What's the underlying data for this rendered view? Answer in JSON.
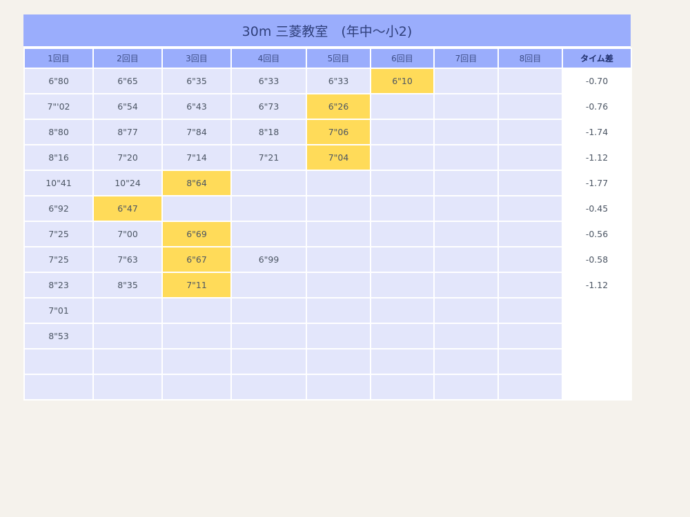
{
  "title": "30m 三菱教室　(年中〜小2)",
  "headers": [
    "1回目",
    "2回目",
    "3回目",
    "4回目",
    "5回目",
    "6回目",
    "7回目",
    "8回目",
    "タイム差"
  ],
  "rows": [
    {
      "cells": [
        "6\"80",
        "6\"65",
        "6\"35",
        "6\"33",
        "6\"33",
        "6\"10",
        "",
        ""
      ],
      "best": 5,
      "diff": "-0.70"
    },
    {
      "cells": [
        "7\"'02",
        "6\"54",
        "6\"43",
        "6\"73",
        "6\"26",
        "",
        "",
        ""
      ],
      "best": 4,
      "diff": "-0.76"
    },
    {
      "cells": [
        "8\"80",
        "8\"77",
        "7\"84",
        "8\"18",
        "7\"06",
        "",
        "",
        ""
      ],
      "best": 4,
      "diff": "-1.74"
    },
    {
      "cells": [
        "8\"16",
        "7\"20",
        "7\"14",
        "7\"21",
        "7\"04",
        "",
        "",
        ""
      ],
      "best": 4,
      "diff": "-1.12"
    },
    {
      "cells": [
        "10\"41",
        "10\"24",
        "8\"64",
        "",
        "",
        "",
        "",
        ""
      ],
      "best": 2,
      "diff": "-1.77"
    },
    {
      "cells": [
        "6\"92",
        "6\"47",
        "",
        "",
        "",
        "",
        "",
        ""
      ],
      "best": 1,
      "diff": "-0.45"
    },
    {
      "cells": [
        "7\"25",
        "7\"00",
        "6\"69",
        "",
        "",
        "",
        "",
        ""
      ],
      "best": 2,
      "diff": "-0.56"
    },
    {
      "cells": [
        "7\"25",
        "7\"63",
        "6\"67",
        "6\"99",
        "",
        "",
        "",
        ""
      ],
      "best": 2,
      "diff": "-0.58"
    },
    {
      "cells": [
        "8\"23",
        "8\"35",
        "7\"11",
        "",
        "",
        "",
        "",
        ""
      ],
      "best": 2,
      "diff": "-1.12"
    },
    {
      "cells": [
        "7\"01",
        "",
        "",
        "",
        "",
        "",
        "",
        ""
      ],
      "best": -1,
      "diff": ""
    },
    {
      "cells": [
        "8\"53",
        "",
        "",
        "",
        "",
        "",
        "",
        ""
      ],
      "best": -1,
      "diff": ""
    },
    {
      "cells": [
        "",
        "",
        "",
        "",
        "",
        "",
        "",
        ""
      ],
      "best": -1,
      "diff": ""
    },
    {
      "cells": [
        "",
        "",
        "",
        "",
        "",
        "",
        "",
        ""
      ],
      "best": -1,
      "diff": ""
    }
  ],
  "colors": {
    "header_bg": "#9aadfc",
    "cell_bg": "#e3e6fb",
    "best_bg": "#ffdb59",
    "diff_bg": "#ffffff",
    "page_bg": "#f5f2ec"
  }
}
